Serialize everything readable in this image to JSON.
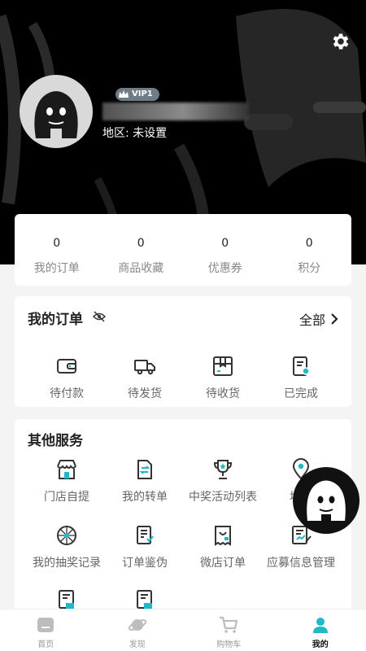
{
  "profile": {
    "vip_label": "VIP1",
    "region": "地区: 未设置"
  },
  "stats": [
    {
      "value": "0",
      "label": "我的订单"
    },
    {
      "value": "0",
      "label": "商品收藏"
    },
    {
      "value": "0",
      "label": "优惠券"
    },
    {
      "value": "0",
      "label": "积分"
    }
  ],
  "orders": {
    "title": "我的订单",
    "all_label": "全部",
    "items": [
      {
        "label": "待付款",
        "icon": "wallet-icon"
      },
      {
        "label": "待发货",
        "icon": "truck-icon"
      },
      {
        "label": "待收货",
        "icon": "box-icon"
      },
      {
        "label": "已完成",
        "icon": "receipt-check-icon"
      }
    ]
  },
  "services": {
    "title": "其他服务",
    "items": [
      {
        "label": "门店自提",
        "icon": "store-icon"
      },
      {
        "label": "我的转单",
        "icon": "transfer-doc-icon"
      },
      {
        "label": "中奖活动列表",
        "icon": "trophy-icon"
      },
      {
        "label": "地址",
        "icon": "location-icon"
      },
      {
        "label": "我的抽奖记录",
        "icon": "wheel-icon"
      },
      {
        "label": "订单鉴伪",
        "icon": "verify-doc-icon"
      },
      {
        "label": "微店订单",
        "icon": "shop-receipt-icon"
      },
      {
        "label": "应募信息管理",
        "icon": "edit-doc-icon"
      },
      {
        "label": "",
        "icon": "doc-icon"
      },
      {
        "label": "",
        "icon": "doc-icon"
      }
    ]
  },
  "tabs": [
    {
      "label": "首页",
      "icon": "home-icon"
    },
    {
      "label": "发现",
      "icon": "planet-icon"
    },
    {
      "label": "购物车",
      "icon": "cart-icon"
    },
    {
      "label": "我的",
      "icon": "user-icon",
      "active": true
    }
  ],
  "colors": {
    "accent": "#21b8c9",
    "hero_bg": "#000000",
    "icon_dark": "#333333"
  }
}
